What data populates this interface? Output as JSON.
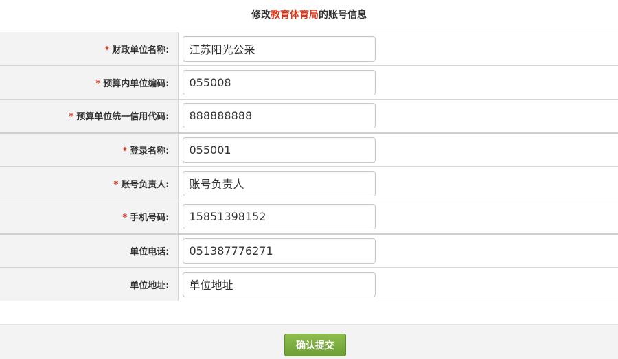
{
  "header": {
    "prefix": "修改",
    "entity": "教育体育局",
    "suffix": "的账号信息"
  },
  "fields": [
    {
      "required_mark": "*",
      "label": "财政单位名称:",
      "value": "江苏阳光公采"
    },
    {
      "required_mark": "*",
      "label": "预算内单位编码:",
      "value": "055008"
    },
    {
      "required_mark": "*",
      "label": "预算单位统一信用代码:",
      "value": "888888888"
    },
    {
      "required_mark": "*",
      "label": "登录名称:",
      "value": "055001"
    },
    {
      "required_mark": "*",
      "label": "账号负责人:",
      "value": "账号负责人"
    },
    {
      "required_mark": "*",
      "label": "手机号码:",
      "value": "15851398152"
    },
    {
      "required_mark": "",
      "label": "单位电话:",
      "value": "051387776271"
    },
    {
      "required_mark": "",
      "label": "单位地址:",
      "value": "单位地址"
    }
  ],
  "footer": {
    "submit_label": "确认提交"
  },
  "colors": {
    "accent_red": "#d9381e",
    "button_green": "#7aac3f",
    "label_bg": "#f3f3f3"
  }
}
